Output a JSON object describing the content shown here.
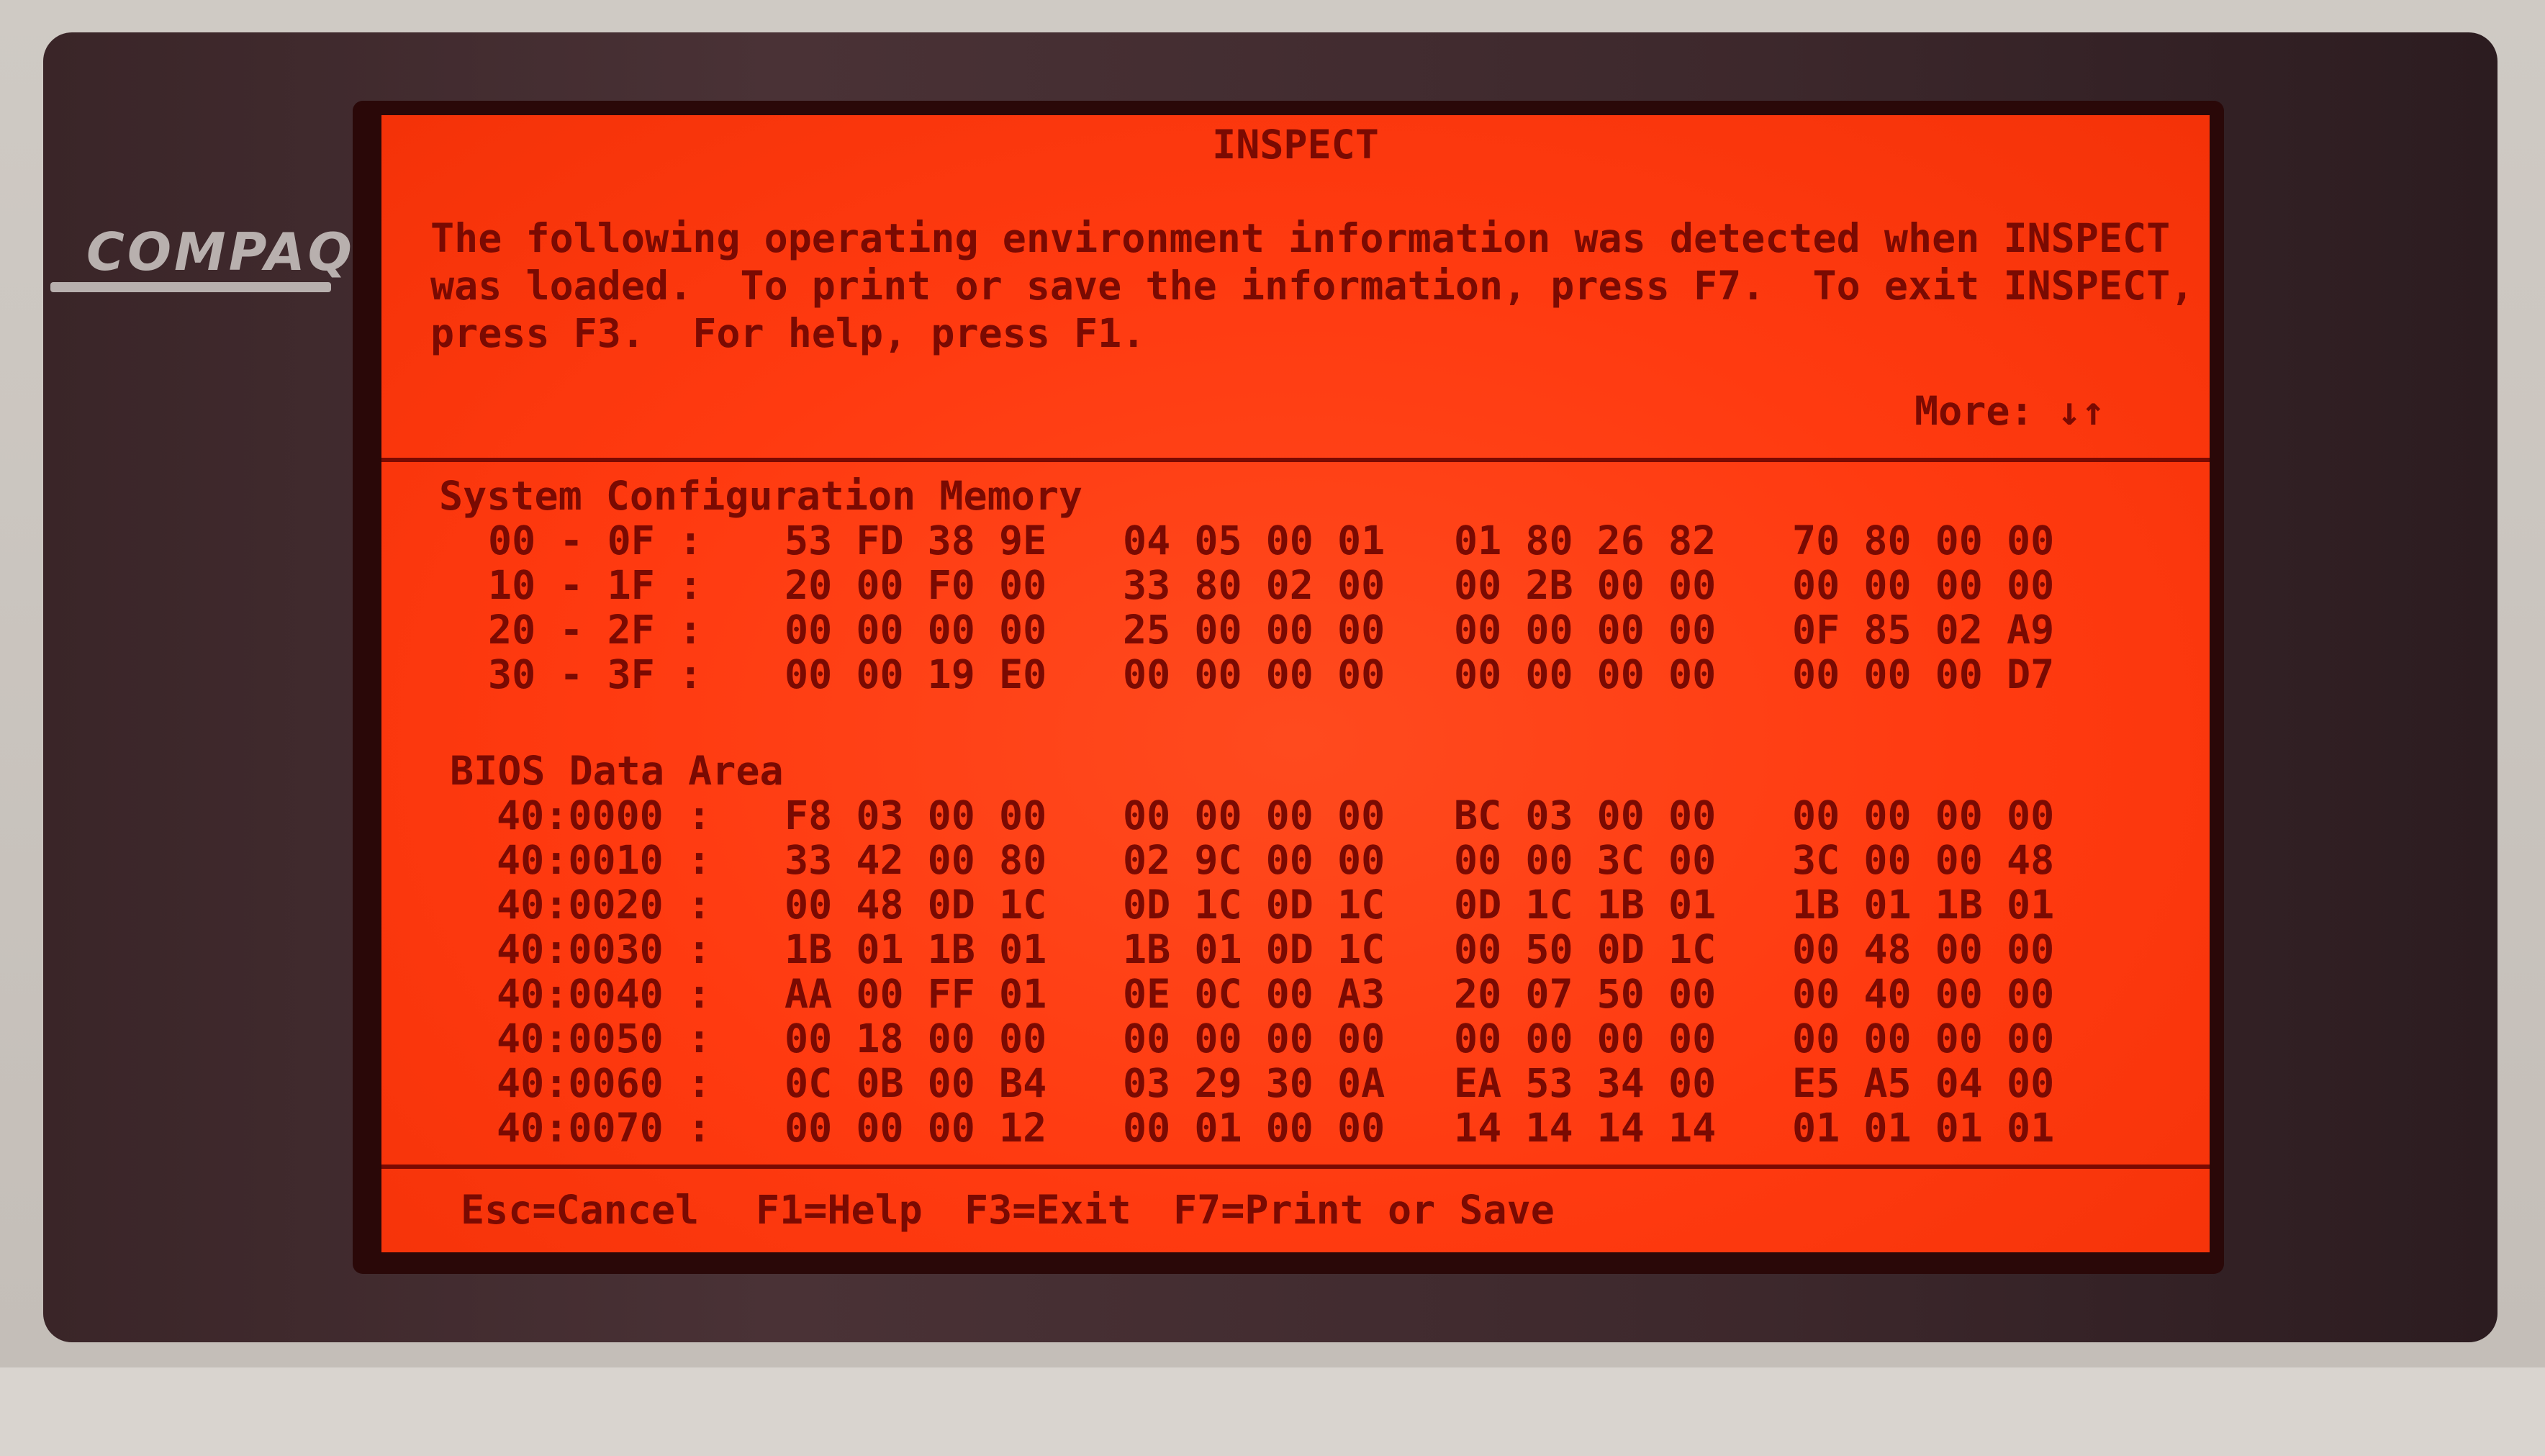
{
  "bezel": {
    "brand": "COMPAQ"
  },
  "screen": {
    "title": "INSPECT",
    "intro": [
      "The following operating environment information was detected when INSPECT",
      "was loaded.  To print or save the information, press F7.  To exit INSPECT,",
      "press F3.  For help, press F1."
    ],
    "more_label": "More: ↓↑",
    "sections": [
      {
        "heading": "System Configuration Memory",
        "rows": [
          {
            "label": "00 - 0F :",
            "groups": [
              "53 FD 38 9E",
              "04 05 00 01",
              "01 80 26 82",
              "70 80 00 00"
            ]
          },
          {
            "label": "10 - 1F :",
            "groups": [
              "20 00 F0 00",
              "33 80 02 00",
              "00 2B 00 00",
              "00 00 00 00"
            ]
          },
          {
            "label": "20 - 2F :",
            "groups": [
              "00 00 00 00",
              "25 00 00 00",
              "00 00 00 00",
              "0F 85 02 A9"
            ]
          },
          {
            "label": "30 - 3F :",
            "groups": [
              "00 00 19 E0",
              "00 00 00 00",
              "00 00 00 00",
              "00 00 00 D7"
            ]
          }
        ]
      },
      {
        "heading": "BIOS Data Area",
        "rows": [
          {
            "label": "40:0000 :",
            "groups": [
              "F8 03 00 00",
              "00 00 00 00",
              "BC 03 00 00",
              "00 00 00 00"
            ]
          },
          {
            "label": "40:0010 :",
            "groups": [
              "33 42 00 80",
              "02 9C 00 00",
              "00 00 3C 00",
              "3C 00 00 48"
            ]
          },
          {
            "label": "40:0020 :",
            "groups": [
              "00 48 0D 1C",
              "0D 1C 0D 1C",
              "0D 1C 1B 01",
              "1B 01 1B 01"
            ]
          },
          {
            "label": "40:0030 :",
            "groups": [
              "1B 01 1B 01",
              "1B 01 0D 1C",
              "00 50 0D 1C",
              "00 48 00 00"
            ]
          },
          {
            "label": "40:0040 :",
            "groups": [
              "AA 00 FF 01",
              "0E 0C 00 A3",
              "20 07 50 00",
              "00 40 00 00"
            ]
          },
          {
            "label": "40:0050 :",
            "groups": [
              "00 18 00 00",
              "00 00 00 00",
              "00 00 00 00",
              "00 00 00 00"
            ]
          },
          {
            "label": "40:0060 :",
            "groups": [
              "0C 0B 00 B4",
              "03 29 30 0A",
              "EA 53 34 00",
              "E5 A5 04 00"
            ]
          },
          {
            "label": "40:0070 :",
            "groups": [
              "00 00 00 12",
              "00 01 00 00",
              "14 14 14 14",
              "01 01 01 01"
            ]
          }
        ]
      }
    ],
    "footer": {
      "cancel": "Esc=Cancel",
      "help": "F1=Help",
      "exit": "F3=Exit",
      "print": "F7=Print or Save"
    }
  },
  "colors": {
    "screen_bg": "#ff3a10",
    "text": "#7a0a02",
    "bezel": "#3d282c"
  }
}
